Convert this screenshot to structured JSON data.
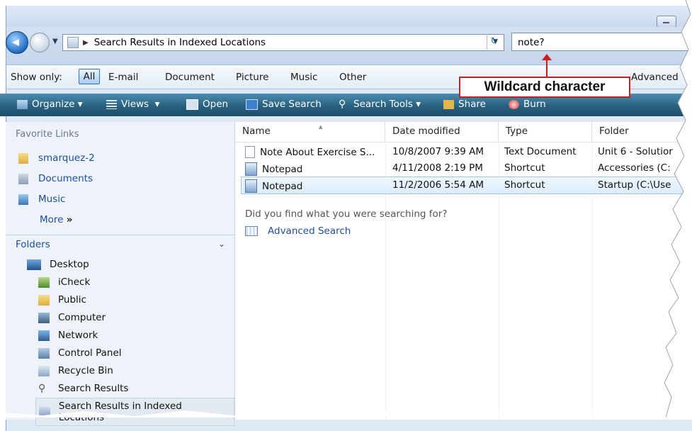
{
  "address": {
    "path": "Search Results in Indexed Locations",
    "search_value": "note?"
  },
  "filter": {
    "label": "Show only:",
    "options": [
      "All",
      "E-mail",
      "Document",
      "Picture",
      "Music",
      "Other"
    ],
    "advanced": "Advanced"
  },
  "toolbar": {
    "items": [
      "Organize",
      "Views",
      "Open",
      "Save Search",
      "Search Tools",
      "Share",
      "Burn"
    ]
  },
  "callout": {
    "text": "Wildcard character",
    "color": "#d11b1b"
  },
  "favorites": {
    "heading": "Favorite Links",
    "items": [
      {
        "label": "smarquez-2",
        "icon": "folder-icon"
      },
      {
        "label": "Documents",
        "icon": "documents-icon"
      },
      {
        "label": "Music",
        "icon": "music-icon"
      }
    ],
    "more": "More",
    "more_glyph": "»"
  },
  "folders": {
    "heading": "Folders",
    "tree": [
      {
        "label": "Desktop",
        "icon": "desktop-icon"
      },
      {
        "label": "iCheck",
        "icon": "icheck-icon"
      },
      {
        "label": "Public",
        "icon": "folder-icon"
      },
      {
        "label": "Computer",
        "icon": "computer-icon"
      },
      {
        "label": "Network",
        "icon": "network-icon"
      },
      {
        "label": "Control Panel",
        "icon": "control-panel-icon"
      },
      {
        "label": "Recycle Bin",
        "icon": "recycle-bin-icon"
      },
      {
        "label": "Search Results",
        "icon": "search-icon"
      },
      {
        "label": "Search Results in Indexed Locations",
        "icon": "search-folder-icon"
      }
    ]
  },
  "columns": [
    "Name",
    "Date modified",
    "Type",
    "Folder"
  ],
  "results": [
    {
      "name": "Note About Exercise S...",
      "date": "10/8/2007 9:39 AM",
      "type": "Text Document",
      "folder": "Unit 6 - Solutior",
      "icon": "text-document-icon"
    },
    {
      "name": "Notepad",
      "date": "4/11/2008 2:19 PM",
      "type": "Shortcut",
      "folder": "Accessories (C:",
      "icon": "shortcut-icon"
    },
    {
      "name": "Notepad",
      "date": "11/2/2006 5:54 AM",
      "type": "Shortcut",
      "folder": "Startup (C:\\Use",
      "icon": "shortcut-icon"
    }
  ],
  "prompt": {
    "question": "Did you find what you were searching for?",
    "link": "Advanced Search"
  }
}
